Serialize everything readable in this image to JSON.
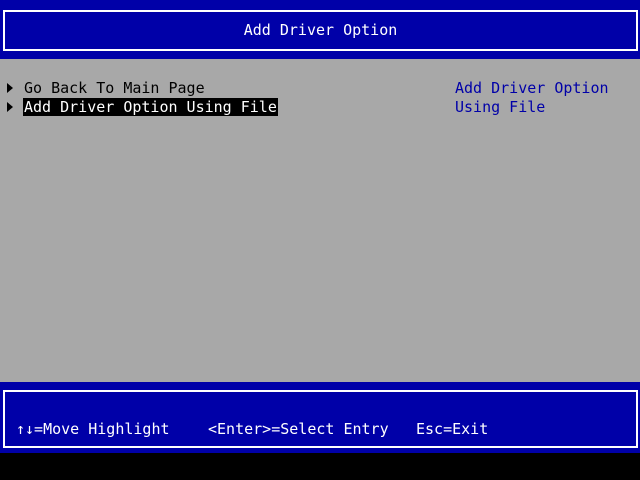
{
  "header": {
    "title": "Add Driver Option"
  },
  "menu": {
    "items": [
      {
        "label": "Go Back To Main Page",
        "selected": false
      },
      {
        "label": "Add Driver Option Using File",
        "selected": true
      }
    ]
  },
  "help": {
    "lines": [
      "Add Driver Option",
      "Using File"
    ]
  },
  "footer": {
    "hints": [
      "↑↓=Move Highlight",
      "<Enter>=Select Entry",
      "Esc=Exit"
    ]
  },
  "colors": {
    "bios_blue": "#0000a8",
    "bios_gray": "#a8a8a8",
    "highlight_bg": "#000000",
    "highlight_fg": "#ffffff"
  }
}
